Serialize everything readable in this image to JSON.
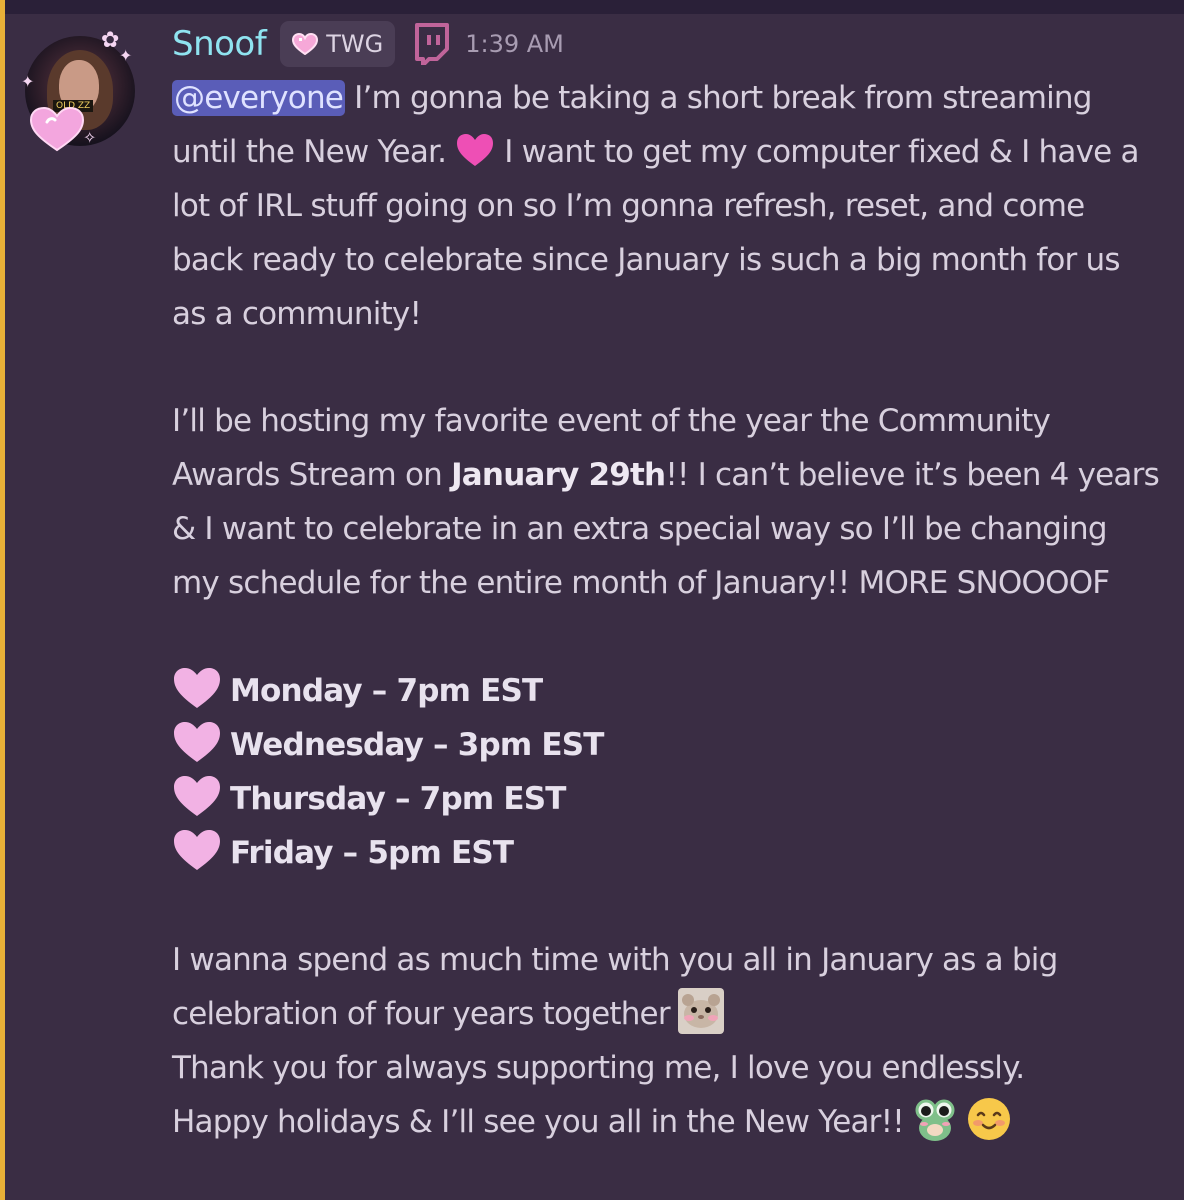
{
  "message": {
    "author": "Snoof",
    "server_tag": "TWG",
    "timestamp": "1:39 AM",
    "mention": "@everyone",
    "paragraph1": " I’m gonna be taking a short break from streaming until the New Year. ",
    "paragraph1_after_heart": " I want to get my computer fixed & I have a lot of IRL stuff going on so I’m gonna refresh, reset, and come back ready to celebrate since January is such a big month for us as a community!",
    "paragraph2_a": "I’ll be hosting my favorite event of the year the Community Awards Stream on ",
    "paragraph2_bold": "January 29th",
    "paragraph2_b": "!! I can’t believe it’s been 4 years & I want to celebrate in an extra special way so I’ll be changing my schedule for the entire month of January!! MORE SNOOOOF",
    "schedule": [
      "Monday – 7pm EST",
      "Wednesday – 3pm EST",
      "Thursday – 7pm EST",
      "Friday – 5pm EST"
    ],
    "paragraph3_a": "I wanna spend as much time with you all in January as a big celebration of four years together",
    "paragraph3_b": "Thank you for always supporting me, I love you endlessly.",
    "paragraph3_c": "Happy holidays & I’ll see you all in the New Year!!",
    "avatar_sign_text": "OLD ZZ"
  },
  "colors": {
    "background": "#3a2d44",
    "username": "#8fe3f0",
    "mention_bg": "#5a5db8",
    "mention_bar": "#e8b038",
    "heart_pink": "#f2b2e4",
    "twitch_purple": "#a970ff"
  },
  "icons": {
    "tag": "pink-heart-icon",
    "platform": "twitch-icon",
    "schedule_bullet": "light-pink-heart-icon",
    "inline_heart": "pink-heart-icon",
    "emoji_1": "hamster-emoji",
    "emoji_2": "frog-emoji",
    "emoji_3": "smiling-face-emoji"
  }
}
